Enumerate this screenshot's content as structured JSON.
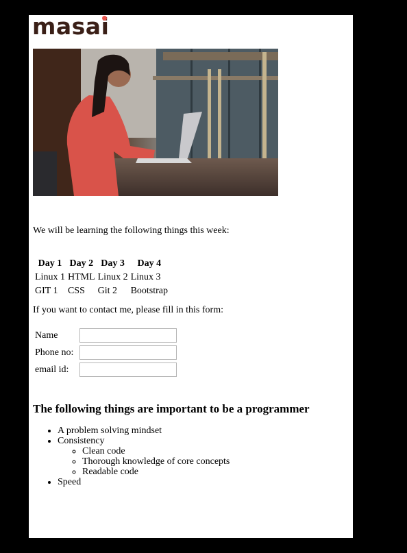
{
  "brand": {
    "logo_text": "masai"
  },
  "intro_text": "We will be learning the following things this week:",
  "schedule": {
    "headers": [
      "Day 1",
      "Day 2",
      "Day 3",
      "Day 4"
    ],
    "rows": [
      [
        "Linux 1",
        "HTML",
        "Linux 2",
        "Linux 3"
      ],
      [
        "GIT 1",
        "CSS",
        "Git 2",
        "Bootstrap"
      ]
    ]
  },
  "contact": {
    "intro": "If you want to contact me, please fill in this form:",
    "fields": [
      {
        "label": "Name",
        "value": ""
      },
      {
        "label": "Phone no:",
        "value": ""
      },
      {
        "label": "email id:",
        "value": ""
      }
    ]
  },
  "important": {
    "heading": "The following things are important to be a programmer",
    "items": [
      {
        "text": "A problem solving mindset"
      },
      {
        "text": "Consistency",
        "subitems": [
          "Clean code",
          "Thorough knowledge of core concepts",
          "Readable code"
        ]
      },
      {
        "text": "Speed"
      }
    ]
  },
  "colors": {
    "page_background": "#000000",
    "content_background": "#ffffff",
    "logo_text": "#3a1f17",
    "logo_dot": "#e8554e"
  }
}
